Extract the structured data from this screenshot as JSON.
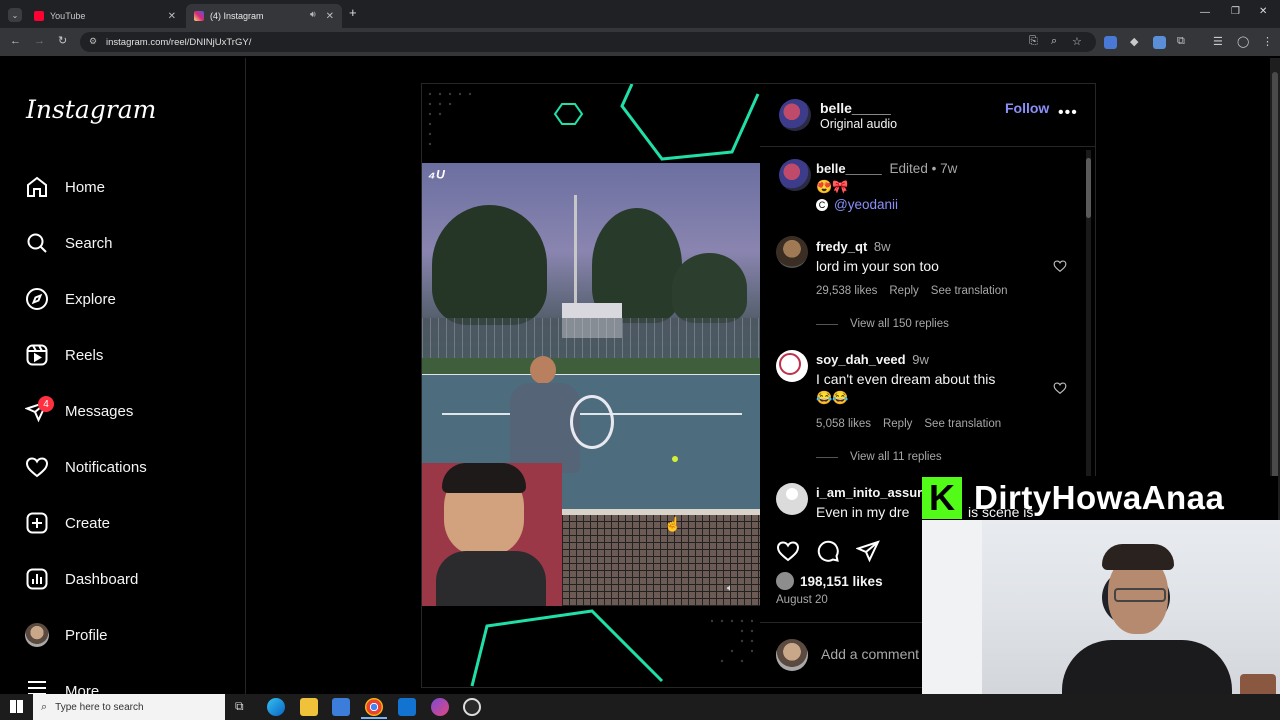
{
  "browser": {
    "tabs": [
      {
        "title": "YouTube",
        "icon": "youtube-icon",
        "active": false
      },
      {
        "title": "(4) Instagram",
        "icon": "instagram-icon",
        "active": true
      }
    ],
    "new_tab": "+",
    "url": "instagram.com/reel/DNINjUxTrGY/"
  },
  "sidebar": {
    "logo": "Instagram",
    "items": [
      {
        "label": "Home",
        "icon": "home-icon"
      },
      {
        "label": "Search",
        "icon": "search-icon"
      },
      {
        "label": "Explore",
        "icon": "explore-compass-icon"
      },
      {
        "label": "Reels",
        "icon": "reels-icon"
      },
      {
        "label": "Messages",
        "icon": "messages-send-icon",
        "badge": "4"
      },
      {
        "label": "Notifications",
        "icon": "heart-icon"
      },
      {
        "label": "Create",
        "icon": "plus-square-icon"
      },
      {
        "label": "Dashboard",
        "icon": "dashboard-chart-icon"
      },
      {
        "label": "Profile",
        "icon": "profile-avatar-icon"
      },
      {
        "label": "More",
        "icon": "menu-icon"
      }
    ]
  },
  "post": {
    "author": "belle_____",
    "audio": "Original audio",
    "follow": "Follow",
    "caption": {
      "author": "belle_____",
      "edited": "Edited",
      "time": "7w",
      "emojis": "😍🎀",
      "mention": "@yeodanii"
    },
    "comments": [
      {
        "user": "fredy_qt",
        "time": "8w",
        "text": "lord im your son too",
        "likes": "29,538 likes",
        "reply": "Reply",
        "translate": "See translation",
        "replies": "View all 150 replies"
      },
      {
        "user": "soy_dah_veed",
        "time": "9w",
        "text": "I can't even dream about this",
        "emojis": "😂😂",
        "likes": "5,058 likes",
        "reply": "Reply",
        "translate": "See translation",
        "replies": "View all 11 replies"
      },
      {
        "user": "i_am_inito_assur",
        "text": "Even in my dre"
      }
    ],
    "comment_tail": "is scene is",
    "likes": "198,151 likes",
    "date": "August 20",
    "add_comment": "Add a comment"
  },
  "overlay": {
    "banner": "DirtyHowaAnaa",
    "k_letter": "K"
  },
  "taskbar": {
    "search_placeholder": "Type here to search"
  }
}
